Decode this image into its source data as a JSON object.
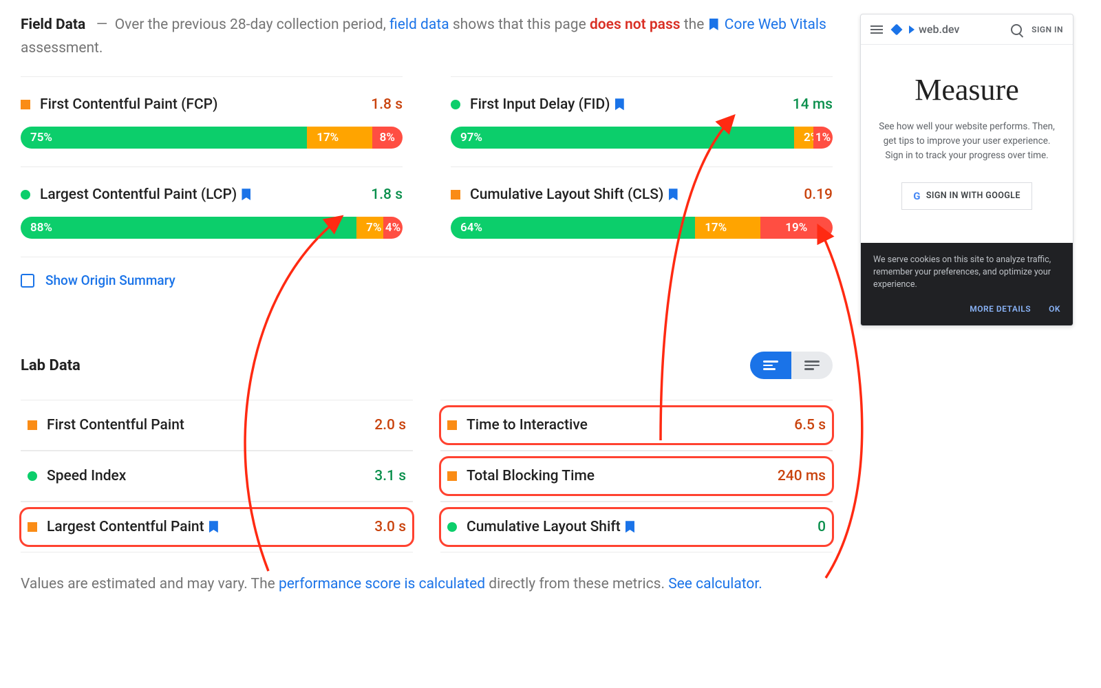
{
  "fieldData": {
    "titleBold": "Field Data",
    "dash": "—",
    "pre": "Over the previous 28-day collection period,",
    "fdLink": "field data",
    "mid": "shows that this page",
    "fail": "does not pass",
    "post": "the",
    "cwvLink": "Core Web Vitals",
    "post2": "assessment.",
    "metrics": [
      {
        "shape": "sq",
        "name": "First Contentful Paint (FCP)",
        "bm": false,
        "val": "1.8 s",
        "vclass": "v-orange",
        "dist": [
          75,
          17,
          8
        ]
      },
      {
        "shape": "ci",
        "name": "First Input Delay (FID)",
        "bm": true,
        "val": "14 ms",
        "vclass": "v-green",
        "dist": [
          97,
          2,
          1
        ]
      },
      {
        "shape": "ci",
        "name": "Largest Contentful Paint (LCP)",
        "bm": true,
        "val": "1.8 s",
        "vclass": "v-green",
        "dist": [
          88,
          7,
          4
        ]
      },
      {
        "shape": "sq",
        "name": "Cumulative Layout Shift (CLS)",
        "bm": true,
        "val": "0.19",
        "vclass": "v-orange",
        "dist": [
          64,
          17,
          19
        ]
      }
    ],
    "originToggle": "Show Origin Summary"
  },
  "labData": {
    "title": "Lab Data",
    "rows": [
      {
        "shape": "sq",
        "name": "First Contentful Paint",
        "bm": false,
        "val": "2.0 s",
        "vclass": "v-orange",
        "hl": false
      },
      {
        "shape": "sq",
        "name": "Time to Interactive",
        "bm": false,
        "val": "6.5 s",
        "vclass": "v-orange",
        "hl": true
      },
      {
        "shape": "ci",
        "name": "Speed Index",
        "bm": false,
        "val": "3.1 s",
        "vclass": "v-green",
        "hl": false
      },
      {
        "shape": "sq",
        "name": "Total Blocking Time",
        "bm": false,
        "val": "240 ms",
        "vclass": "v-orange",
        "hl": true
      },
      {
        "shape": "sq",
        "name": "Largest Contentful Paint",
        "bm": true,
        "val": "3.0 s",
        "vclass": "v-orange",
        "hl": true
      },
      {
        "shape": "ci",
        "name": "Cumulative Layout Shift",
        "bm": true,
        "val": "0",
        "vclass": "v-green",
        "hl": true
      }
    ],
    "footPre": "Values are estimated and may vary. The",
    "footLink1": "performance score is calculated",
    "footMid": "directly from these metrics.",
    "footLink2": "See calculator."
  },
  "phone": {
    "brand": "web.dev",
    "signin": "SIGN IN",
    "heading": "Measure",
    "body": "See how well your website performs. Then, get tips to improve your user experience. Sign in to track your progress over time.",
    "button": "SIGN IN WITH GOOGLE",
    "cookie": "We serve cookies on this site to analyze traffic, remember your preferences, and optimize your experience.",
    "more": "MORE DETAILS",
    "ok": "OK"
  }
}
